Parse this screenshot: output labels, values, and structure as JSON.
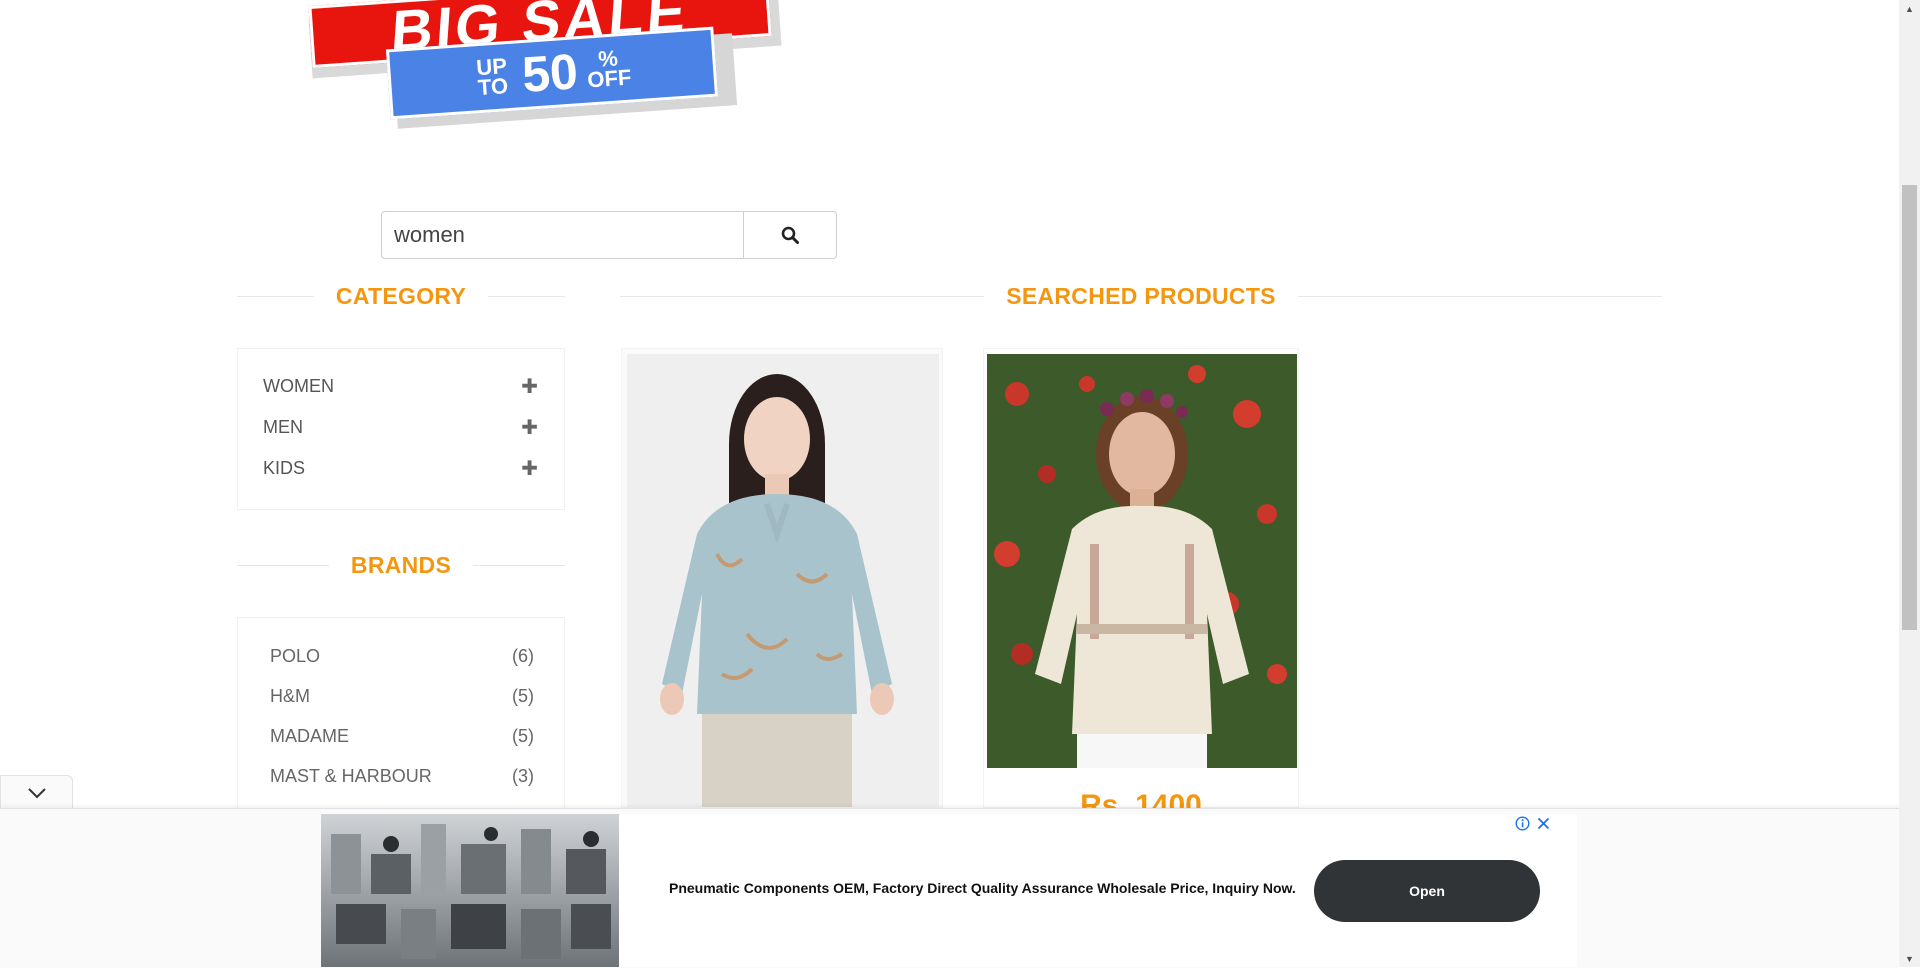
{
  "banner": {
    "headline": "BIG SALE",
    "up_to": "UP TO",
    "percent": "50",
    "off": "% OFF"
  },
  "search": {
    "value": "women",
    "button_icon": "search-icon"
  },
  "sidebar": {
    "category_title": "CATEGORY",
    "categories": [
      {
        "label": "WOMEN",
        "icon": "plus-icon"
      },
      {
        "label": "MEN",
        "icon": "plus-icon"
      },
      {
        "label": "KIDS",
        "icon": "plus-icon"
      }
    ],
    "brands_title": "BRANDS",
    "brands": [
      {
        "label": "POLO",
        "count": "(6)"
      },
      {
        "label": "H&M",
        "count": "(5)"
      },
      {
        "label": "MADAME",
        "count": "(5)"
      },
      {
        "label": "MAST & HARBOUR",
        "count": "(3)"
      }
    ]
  },
  "main": {
    "title": "SEARCHED PRODUCTS",
    "products": [
      {
        "image": "woman-floral-top-photo"
      },
      {
        "image": "woman-cream-top-photo",
        "price": "Rs. 1400"
      }
    ]
  },
  "ad": {
    "text": "Pneumatic Components OEM, Factory Direct Quality Assurance Wholesale Price, Inquiry Now.",
    "button_label": "Open",
    "info_icon": "info-icon",
    "close_icon": "close-icon",
    "collapse_icon": "chevron-down-icon"
  },
  "colors": {
    "accent": "#f5960f",
    "sale_red": "#e8150f",
    "sale_blue": "#4a82e6",
    "ad_button": "#313437"
  }
}
